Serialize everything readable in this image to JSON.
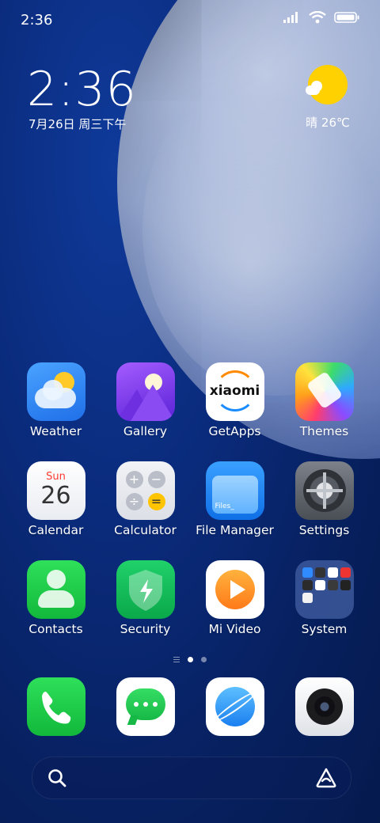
{
  "status_bar": {
    "time": "2:36"
  },
  "lock_widget": {
    "time": "2:36",
    "date": "7月26日 周三下午",
    "weather": "晴 26℃"
  },
  "apps": [
    {
      "label": "Weather"
    },
    {
      "label": "Gallery"
    },
    {
      "label": "GetApps"
    },
    {
      "label": "Themes"
    },
    {
      "label": "Calendar"
    },
    {
      "label": "Calculator"
    },
    {
      "label": "File Manager"
    },
    {
      "label": "Settings"
    },
    {
      "label": "Contacts"
    },
    {
      "label": "Security"
    },
    {
      "label": "Mi Video"
    },
    {
      "label": "System"
    }
  ],
  "icon_text": {
    "calendar_day_name": "Sun",
    "calendar_day": "26",
    "getapps_logo": "xiaomi",
    "files": "Files_"
  },
  "colors": {
    "accent": "#0a2a7a",
    "phone_green": "#1fd14a",
    "sun_yellow": "#ffd100"
  }
}
